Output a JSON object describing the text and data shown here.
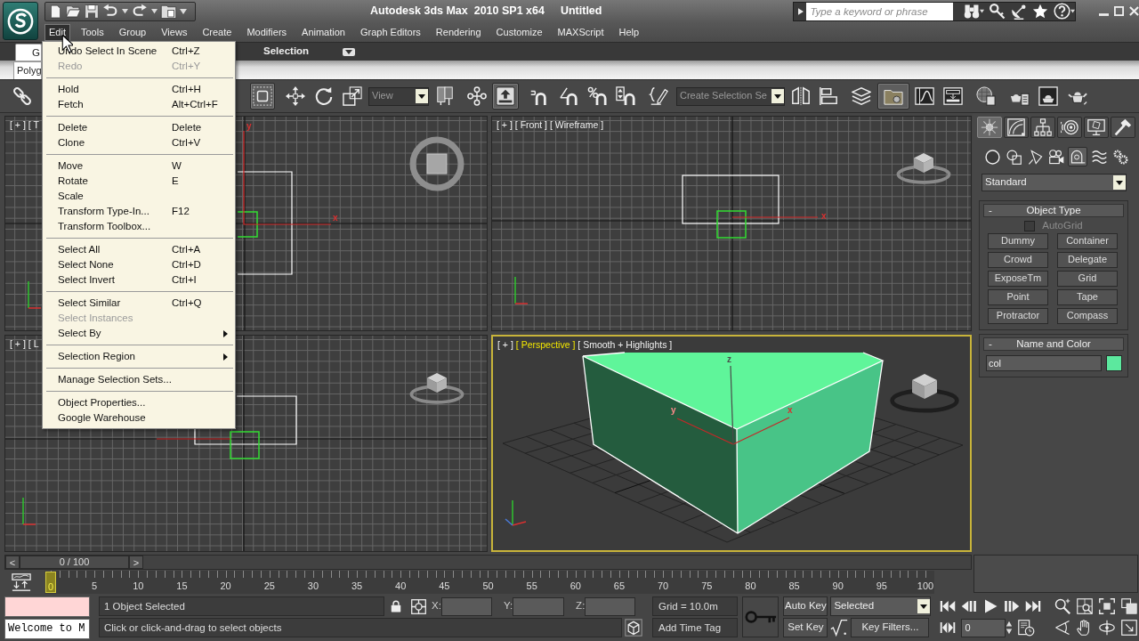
{
  "window": {
    "title": "Autodesk 3ds Max  2010 SP1 x64",
    "document": "Untitled"
  },
  "search": {
    "placeholder": "Type a keyword or phrase"
  },
  "menu_bar": [
    {
      "label": "Edit",
      "selected": true
    },
    {
      "label": "Tools",
      "selected": false
    },
    {
      "label": "Group",
      "selected": false
    },
    {
      "label": "Views",
      "selected": false
    },
    {
      "label": "Create",
      "selected": false
    },
    {
      "label": "Modifiers",
      "selected": false
    },
    {
      "label": "Animation",
      "selected": false
    },
    {
      "label": "Graph Editors",
      "selected": false
    },
    {
      "label": "Rendering",
      "selected": false
    },
    {
      "label": "Customize",
      "selected": false
    },
    {
      "label": "MAXScript",
      "selected": false
    },
    {
      "label": "Help",
      "selected": false
    }
  ],
  "edit_menu": {
    "groups": [
      [
        {
          "label": "Undo Select In Scene",
          "shortcut": "Ctrl+Z",
          "disabled": false,
          "submenu": false
        },
        {
          "label": "Redo",
          "shortcut": "Ctrl+Y",
          "disabled": true,
          "submenu": false
        }
      ],
      [
        {
          "label": "Hold",
          "shortcut": "Ctrl+H",
          "disabled": false,
          "submenu": false
        },
        {
          "label": "Fetch",
          "shortcut": "Alt+Ctrl+F",
          "disabled": false,
          "submenu": false
        }
      ],
      [
        {
          "label": "Delete",
          "shortcut": "Delete",
          "disabled": false,
          "submenu": false
        },
        {
          "label": "Clone",
          "shortcut": "Ctrl+V",
          "disabled": false,
          "submenu": false
        }
      ],
      [
        {
          "label": "Move",
          "shortcut": "W",
          "disabled": false,
          "submenu": false
        },
        {
          "label": "Rotate",
          "shortcut": "E",
          "disabled": false,
          "submenu": false
        },
        {
          "label": "Scale",
          "disabled": false,
          "submenu": false
        },
        {
          "label": "Transform Type-In...",
          "shortcut": "F12",
          "disabled": false,
          "submenu": false
        },
        {
          "label": "Transform Toolbox...",
          "disabled": false,
          "submenu": false
        }
      ],
      [
        {
          "label": "Select All",
          "shortcut": "Ctrl+A",
          "disabled": false,
          "submenu": false
        },
        {
          "label": "Select None",
          "shortcut": "Ctrl+D",
          "disabled": false,
          "submenu": false
        },
        {
          "label": "Select Invert",
          "shortcut": "Ctrl+I",
          "disabled": false,
          "submenu": false
        }
      ],
      [
        {
          "label": "Select Similar",
          "shortcut": "Ctrl+Q",
          "disabled": false,
          "submenu": false
        },
        {
          "label": "Select Instances",
          "disabled": true,
          "submenu": false
        },
        {
          "label": "Select By",
          "disabled": false,
          "submenu": true
        }
      ],
      [
        {
          "label": "Selection Region",
          "disabled": false,
          "submenu": true
        }
      ],
      [
        {
          "label": "Manage Selection Sets...",
          "disabled": false,
          "submenu": false
        }
      ],
      [
        {
          "label": "Object Properties...",
          "disabled": false,
          "submenu": false
        },
        {
          "label": "Google Warehouse",
          "disabled": false,
          "submenu": false
        }
      ]
    ]
  },
  "ribbon": {
    "tabs": [
      {
        "label": "G",
        "selected": true
      }
    ],
    "panel_title": "Selection",
    "subtabs": [
      {
        "label": "Polyg",
        "selected": true
      }
    ]
  },
  "main_toolbar": [
    {
      "kind": "button",
      "on": false
    },
    {
      "kind": "button",
      "on": true
    },
    {
      "kind": "button",
      "on": false
    },
    {
      "kind": "button",
      "on": false
    },
    {
      "kind": "button",
      "on": false
    },
    {
      "kind": "dropdown",
      "value": "View"
    },
    {
      "kind": "button",
      "on": false
    },
    {
      "kind": "button",
      "on": false
    },
    {
      "kind": "button",
      "on": true
    },
    {
      "kind": "button",
      "on": false
    },
    {
      "kind": "button",
      "on": false
    },
    {
      "kind": "button",
      "on": false
    },
    {
      "kind": "button",
      "on": false
    },
    {
      "kind": "button",
      "on": false
    },
    {
      "kind": "dropdown",
      "value": "Create Selection Se"
    },
    {
      "kind": "button",
      "on": false
    },
    {
      "kind": "button",
      "on": false
    },
    {
      "kind": "button",
      "on": false
    },
    {
      "kind": "button",
      "on": true
    },
    {
      "kind": "button",
      "on": false
    },
    {
      "kind": "button",
      "on": false
    },
    {
      "kind": "button",
      "on": false
    },
    {
      "kind": "button",
      "on": false
    },
    {
      "kind": "button",
      "on": false
    },
    {
      "kind": "button",
      "on": false
    }
  ],
  "viewports": [
    {
      "labels": [
        "[ + ]",
        "[ T"
      ],
      "axis_labels": [
        {
          "text": "x",
          "color": "#d83030"
        },
        {
          "text": "y",
          "color": "#d83030"
        }
      ],
      "active": false
    },
    {
      "labels": [
        "[ + ]",
        "[ Front ]",
        "[ Wireframe ]"
      ],
      "axis_labels": [
        {
          "text": "x",
          "color": "#d83030"
        }
      ],
      "active": false
    },
    {
      "labels": [
        "[ + ]",
        "[ L"
      ],
      "active": false
    },
    {
      "labels": [
        "[ + ]",
        "[ Perspective ]",
        "[ Smooth + Highlights ]"
      ],
      "axis_labels": [
        {
          "text": "z",
          "color": "#4a4a4a"
        },
        {
          "text": "y",
          "color": "#ff8a8a"
        },
        {
          "text": "x",
          "color": "#d83030"
        }
      ],
      "active": true
    }
  ],
  "command_panel": {
    "tabs": [
      {
        "selected": true
      },
      {
        "selected": false
      },
      {
        "selected": false
      },
      {
        "selected": false
      },
      {
        "selected": false
      },
      {
        "selected": false
      }
    ],
    "categories": [
      {
        "selected": false
      },
      {
        "selected": false
      },
      {
        "selected": false
      },
      {
        "selected": false
      },
      {
        "selected": true
      },
      {
        "selected": false
      },
      {
        "selected": false
      }
    ],
    "object_category": "Standard",
    "rollouts": [
      {
        "kind": "object_type",
        "toggle": "-",
        "title": "Object Type",
        "checkbox": {
          "label": "AutoGrid",
          "checked": false,
          "disabled": true
        },
        "buttons": [
          "Dummy",
          "Container",
          "Crowd",
          "Delegate",
          "ExposeTm",
          "Grid",
          "Point",
          "Tape",
          "Protractor",
          "Compass"
        ]
      },
      {
        "kind": "name_color",
        "toggle": "-",
        "title": "Name and Color",
        "name": "col",
        "swatch": {
          "color": "#5ce89e"
        }
      }
    ]
  },
  "time_slider": {
    "prev": "<",
    "position": "0 / 100",
    "next": ">"
  },
  "track_bar": {
    "ticks": [
      {
        "label": "0",
        "selected": true
      },
      {
        "label": "5",
        "selected": false
      },
      {
        "label": "10",
        "selected": false
      },
      {
        "label": "15",
        "selected": false
      },
      {
        "label": "20",
        "selected": false
      },
      {
        "label": "25",
        "selected": false
      },
      {
        "label": "30",
        "selected": false
      },
      {
        "label": "35",
        "selected": false
      },
      {
        "label": "40",
        "selected": false
      },
      {
        "label": "45",
        "selected": false
      },
      {
        "label": "50",
        "selected": false
      },
      {
        "label": "55",
        "selected": false
      },
      {
        "label": "60",
        "selected": false
      },
      {
        "label": "65",
        "selected": false
      },
      {
        "label": "70",
        "selected": false
      },
      {
        "label": "75",
        "selected": false
      },
      {
        "label": "80",
        "selected": false
      },
      {
        "label": "85",
        "selected": false
      },
      {
        "label": "90",
        "selected": false
      },
      {
        "label": "95",
        "selected": false
      },
      {
        "label": "100",
        "selected": false
      }
    ]
  },
  "status_bar": {
    "listener_output": "Welcome to M",
    "selection": "1 Object Selected",
    "prompt": "Click or click-and-drag to select objects",
    "coordinates": [
      {
        "label": "X:"
      },
      {
        "label": "Y:"
      },
      {
        "label": "Z:"
      }
    ],
    "grid": "Grid = 10.0m",
    "time_tag": "Add Time Tag"
  },
  "animation_controls": {
    "auto_key": "Auto Key",
    "key_set": "Selected",
    "set_key": "Set Key",
    "key_filters": "Key Filters...",
    "current_frame": "0"
  }
}
